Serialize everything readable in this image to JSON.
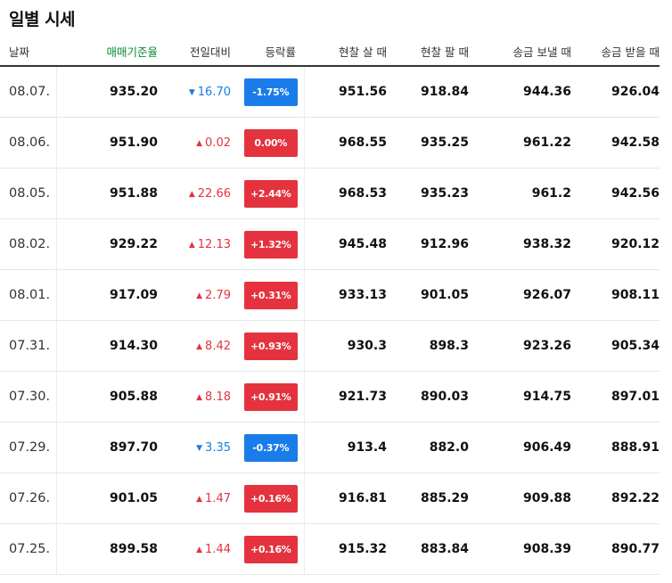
{
  "title": "일별 시세",
  "colors": {
    "up": "#e4333e",
    "down": "#1a7ce8",
    "base_header": "#0b8a35"
  },
  "headers": {
    "date": "날짜",
    "base_rate": "매매기준율",
    "change": "전일대비",
    "change_rate": "등락률",
    "cash_buy": "현찰 살 때",
    "cash_sell": "현찰 팔 때",
    "transfer_send": "송금 보낼 때",
    "transfer_receive": "송금 받을 때"
  },
  "rows": [
    {
      "date": "08.07.",
      "base": "935.20",
      "dir": "down",
      "arrow": "▼",
      "change": "16.70",
      "rate": "-1.75%",
      "cash_buy": "951.56",
      "cash_sell": "918.84",
      "send": "944.36",
      "receive": "926.04"
    },
    {
      "date": "08.06.",
      "base": "951.90",
      "dir": "up",
      "arrow": "▲",
      "change": "0.02",
      "rate": "0.00%",
      "cash_buy": "968.55",
      "cash_sell": "935.25",
      "send": "961.22",
      "receive": "942.58"
    },
    {
      "date": "08.05.",
      "base": "951.88",
      "dir": "up",
      "arrow": "▲",
      "change": "22.66",
      "rate": "+2.44%",
      "cash_buy": "968.53",
      "cash_sell": "935.23",
      "send": "961.2",
      "receive": "942.56"
    },
    {
      "date": "08.02.",
      "base": "929.22",
      "dir": "up",
      "arrow": "▲",
      "change": "12.13",
      "rate": "+1.32%",
      "cash_buy": "945.48",
      "cash_sell": "912.96",
      "send": "938.32",
      "receive": "920.12"
    },
    {
      "date": "08.01.",
      "base": "917.09",
      "dir": "up",
      "arrow": "▲",
      "change": "2.79",
      "rate": "+0.31%",
      "cash_buy": "933.13",
      "cash_sell": "901.05",
      "send": "926.07",
      "receive": "908.11"
    },
    {
      "date": "07.31.",
      "base": "914.30",
      "dir": "up",
      "arrow": "▲",
      "change": "8.42",
      "rate": "+0.93%",
      "cash_buy": "930.3",
      "cash_sell": "898.3",
      "send": "923.26",
      "receive": "905.34"
    },
    {
      "date": "07.30.",
      "base": "905.88",
      "dir": "up",
      "arrow": "▲",
      "change": "8.18",
      "rate": "+0.91%",
      "cash_buy": "921.73",
      "cash_sell": "890.03",
      "send": "914.75",
      "receive": "897.01"
    },
    {
      "date": "07.29.",
      "base": "897.70",
      "dir": "down",
      "arrow": "▼",
      "change": "3.35",
      "rate": "-0.37%",
      "cash_buy": "913.4",
      "cash_sell": "882.0",
      "send": "906.49",
      "receive": "888.91"
    },
    {
      "date": "07.26.",
      "base": "901.05",
      "dir": "up",
      "arrow": "▲",
      "change": "1.47",
      "rate": "+0.16%",
      "cash_buy": "916.81",
      "cash_sell": "885.29",
      "send": "909.88",
      "receive": "892.22"
    },
    {
      "date": "07.25.",
      "base": "899.58",
      "dir": "up",
      "arrow": "▲",
      "change": "1.44",
      "rate": "+0.16%",
      "cash_buy": "915.32",
      "cash_sell": "883.84",
      "send": "908.39",
      "receive": "890.77"
    }
  ]
}
